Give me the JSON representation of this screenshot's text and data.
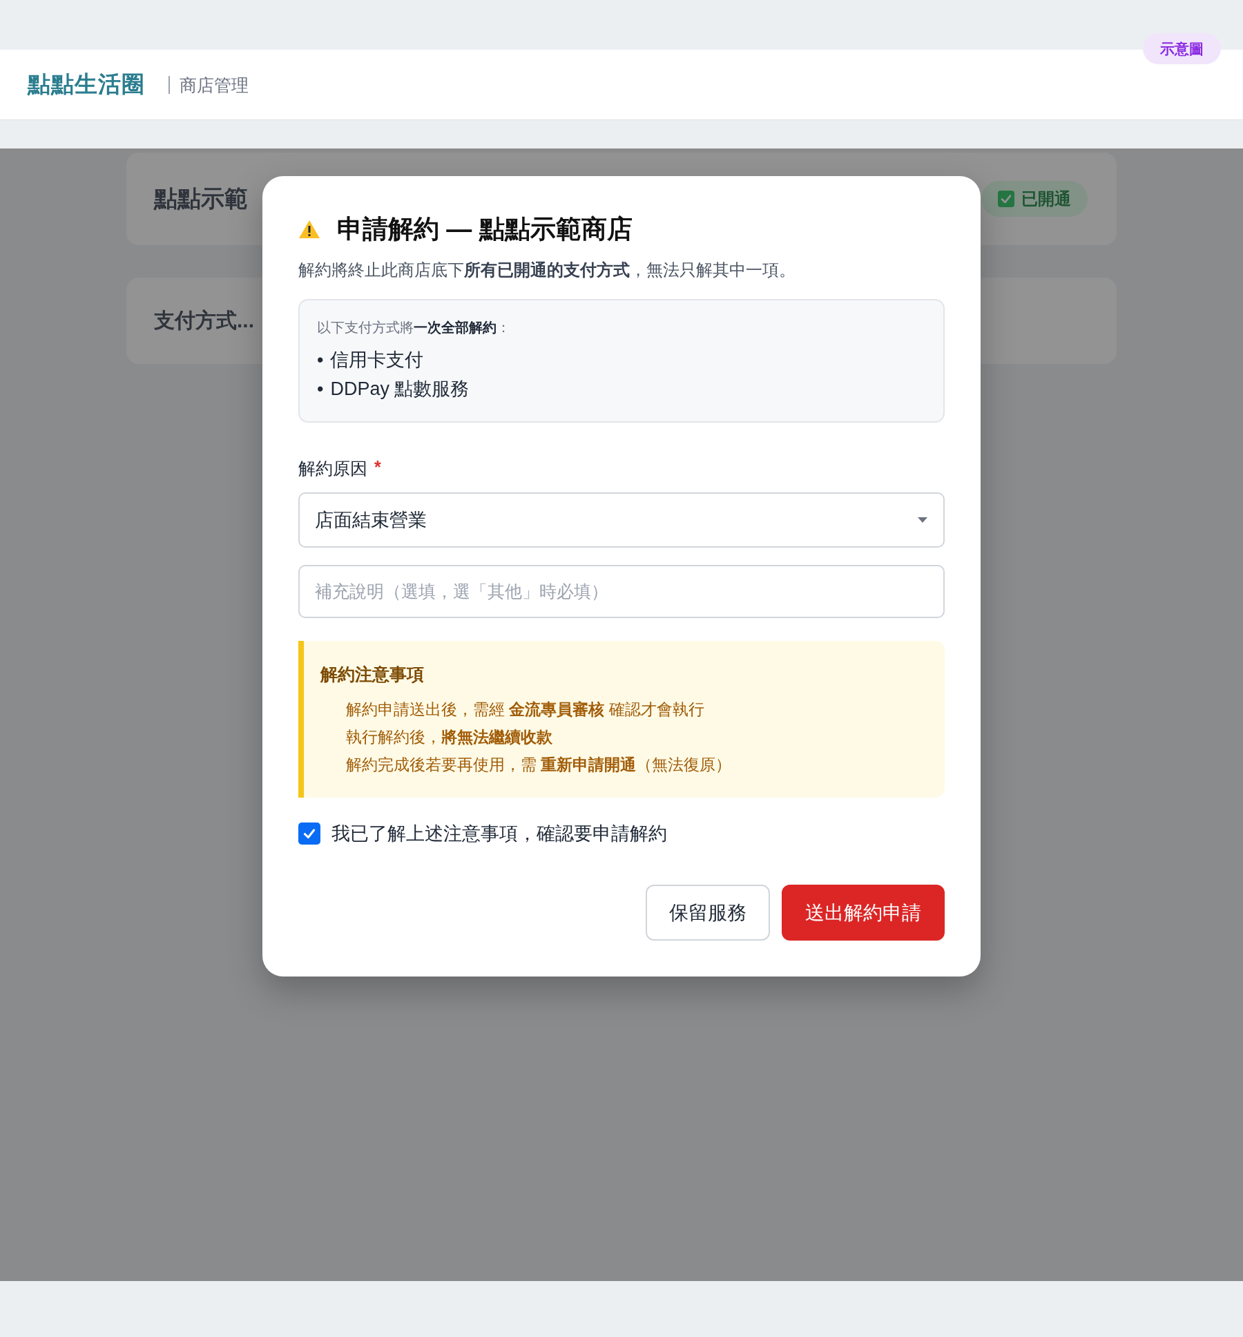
{
  "badge": "示意圖",
  "header": {
    "logo": "點點生活圈",
    "subtitle": "商店管理"
  },
  "background": {
    "store_title": "點點示範",
    "status_badge": {
      "label": "已開通",
      "checked": true
    },
    "section_title": "支付方式..."
  },
  "modal": {
    "title": "申請解約 — 點點示範商店",
    "description": "解約將終止此商店底下**所有已開通的支付方式**，無法只解其中一項。",
    "methods_box": {
      "intro": "以下支付方式將**一次全部解約**：",
      "bullet": "•",
      "items": [
        "信用卡支付",
        "DDPay 點數服務"
      ]
    },
    "reason": {
      "label": "解約原因",
      "required_mark": "*",
      "value": "店面結束營業"
    },
    "note": {
      "placeholder": "補充說明（選填，選「其他」時必填）"
    },
    "notice": {
      "title": "解約注意事項",
      "items": [
        "解約申請送出後，需經 **金流專員審核** 確認才會執行",
        "執行解約後，**將無法繼續收款**",
        "解約完成後若要再使用，需 **重新申請開通**（無法復原）"
      ]
    },
    "confirm": {
      "label": "我已了解上述注意事項，確認要申請解約",
      "checked": true
    },
    "buttons": [
      {
        "label": "保留服務",
        "kind": "secondary"
      },
      {
        "label": "送出解約申請",
        "kind": "danger"
      }
    ]
  }
}
